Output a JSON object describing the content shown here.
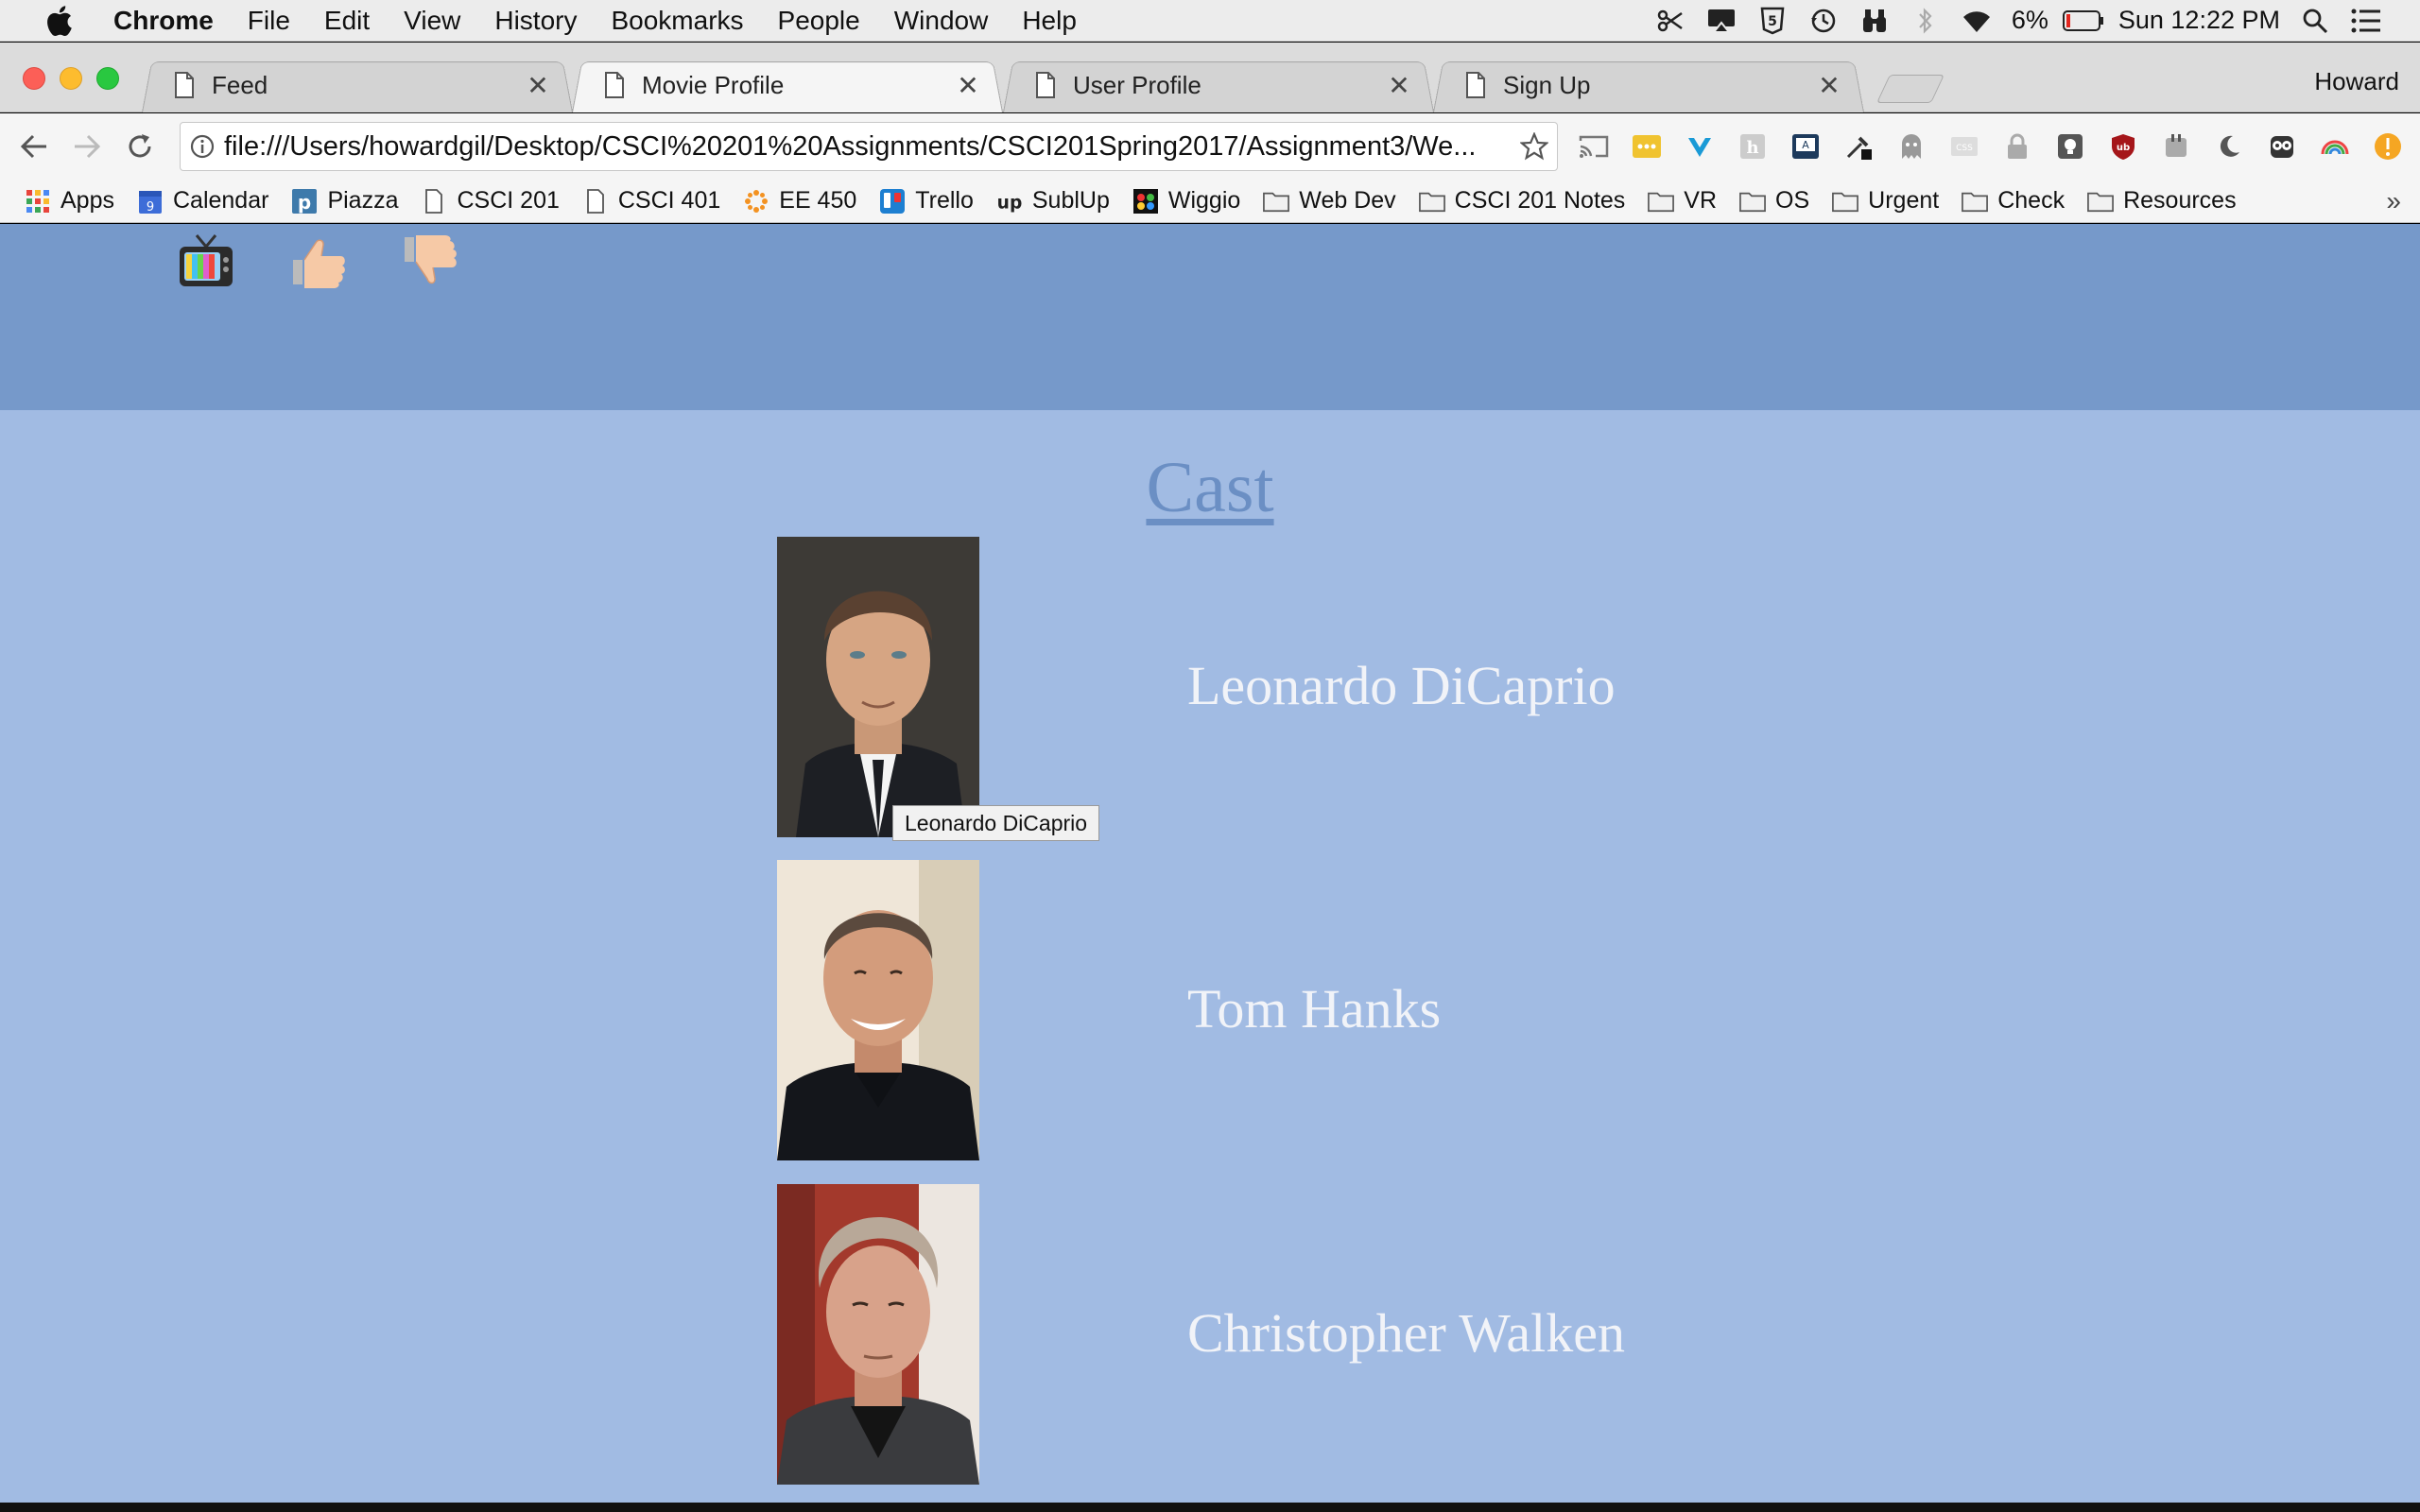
{
  "menubar": {
    "app_name": "Chrome",
    "items": [
      "File",
      "Edit",
      "View",
      "History",
      "Bookmarks",
      "People",
      "Window",
      "Help"
    ],
    "battery": "6%",
    "clock": "Sun 12:22 PM"
  },
  "tabs": [
    {
      "title": "Feed",
      "active": false
    },
    {
      "title": "Movie Profile",
      "active": true
    },
    {
      "title": "User Profile",
      "active": false
    },
    {
      "title": "Sign Up",
      "active": false
    }
  ],
  "profile_name": "Howard",
  "toolbar": {
    "url": "file:///Users/howardgil/Desktop/CSCI%20201%20Assignments/CSCI201Spring2017/Assignment3/We..."
  },
  "bookmarks": [
    {
      "label": "Apps",
      "icon": "apps-grid-icon"
    },
    {
      "label": "Calendar",
      "icon": "calendar-icon"
    },
    {
      "label": "Piazza",
      "icon": "piazza-icon"
    },
    {
      "label": "CSCI 201",
      "icon": "page-icon"
    },
    {
      "label": "CSCI 401",
      "icon": "page-icon"
    },
    {
      "label": "EE 450",
      "icon": "ee450-icon"
    },
    {
      "label": "Trello",
      "icon": "trello-icon"
    },
    {
      "label": "SublUp",
      "icon": "sublup-icon"
    },
    {
      "label": "Wiggio",
      "icon": "wiggio-icon"
    },
    {
      "label": "Web Dev",
      "icon": "folder-icon"
    },
    {
      "label": "CSCI 201 Notes",
      "icon": "folder-icon"
    },
    {
      "label": "VR",
      "icon": "folder-icon"
    },
    {
      "label": "OS",
      "icon": "folder-icon"
    },
    {
      "label": "Urgent",
      "icon": "folder-icon"
    },
    {
      "label": "Check",
      "icon": "folder-icon"
    },
    {
      "label": "Resources",
      "icon": "folder-icon"
    }
  ],
  "page": {
    "cast_title": "Cast",
    "cast": [
      {
        "name": "Leonardo DiCaprio"
      },
      {
        "name": "Tom Hanks"
      },
      {
        "name": "Christopher Walken"
      }
    ],
    "tooltip": "Leonardo DiCaprio"
  },
  "colors": {
    "header_bg": "#7699ca",
    "page_bg": "#a1bbe3",
    "cast_title": "#6b8fc4",
    "cast_name": "#f1f3f8"
  }
}
